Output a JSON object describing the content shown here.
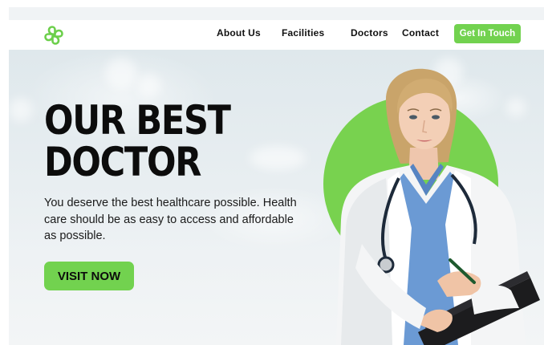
{
  "header": {
    "logo_icon": "clover-cross-icon",
    "nav": [
      "About Us",
      "Facilities",
      "Doctors",
      "Contact"
    ],
    "cta_label": "Get In Touch"
  },
  "hero": {
    "title_line1": "OUR BEST",
    "title_line2": "DOCTOR",
    "description": "You deserve the best healthcare possible. Health care should be as easy to access and affordable as possible.",
    "button_label": "VISIT NOW"
  },
  "colors": {
    "accent": "#72d24f",
    "text": "#0c0c0c",
    "header_bg": "#ffffff"
  }
}
